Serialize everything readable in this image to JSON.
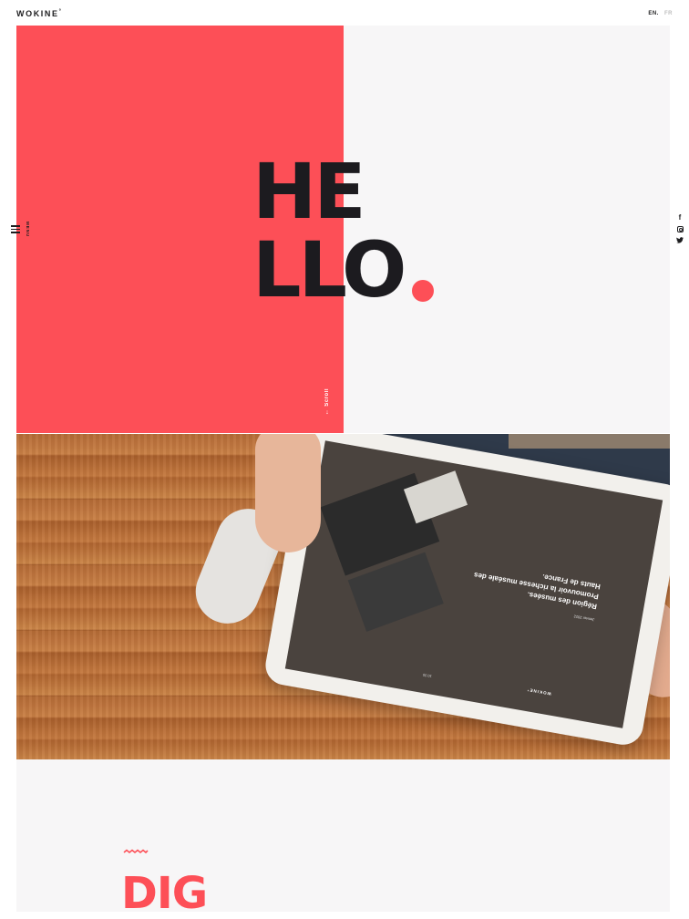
{
  "header": {
    "logo": "WOKINE",
    "logo_mark": "°",
    "lang_active": "EN.",
    "lang_other": "FR"
  },
  "nav": {
    "menu_label": "MENU"
  },
  "hero": {
    "headline_line1": "HE",
    "headline_line2": "LLO",
    "headline_dot": ".",
    "scroll_label": "Scroll",
    "scroll_arrow": "→"
  },
  "social": [
    "facebook-icon",
    "instagram-icon",
    "twitter-icon"
  ],
  "social_glyphs": {
    "facebook": "f",
    "twitter": "ʷ"
  },
  "project_image": {
    "tablet_subtitle": "Janvier 2022",
    "tablet_title": "Région des musées.",
    "tablet_body": "Promouvoir la richesse muséale des Hauts de France.",
    "tablet_brand": "WOKINE°",
    "tablet_time": "10:30"
  },
  "section": {
    "heading": "DIG"
  },
  "colors": {
    "accent": "#fd4f57",
    "dark": "#1c1b1f",
    "background_light": "#f7f6f7"
  }
}
